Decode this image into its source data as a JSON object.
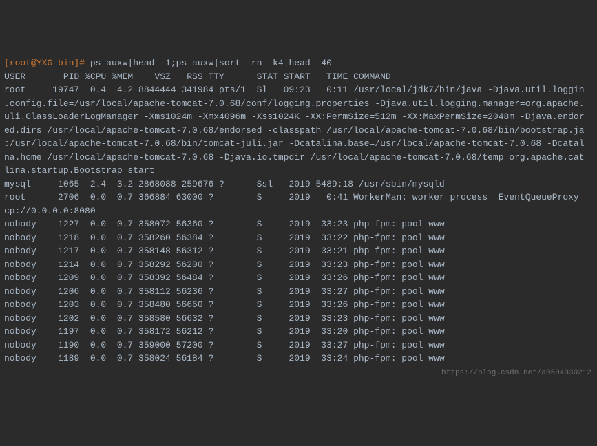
{
  "prompt": "[root@YXG bin]# ",
  "command": "ps auxw|head -1;ps auxw|sort -rn -k4|head -40",
  "header": "USER       PID %CPU %MEM    VSZ   RSS TTY      STAT START   TIME COMMAND",
  "wrapped_process": "root     19747  0.4  4.2 8844444 341984 pts/1  Sl   09:23   0:11 /usr/local/jdk7/bin/java -Djava.util.loggin\n.config.file=/usr/local/apache-tomcat-7.0.68/conf/logging.properties -Djava.util.logging.manager=org.apache.\nuli.ClassLoaderLogManager -Xms1024m -Xmx4096m -Xss1024K -XX:PermSize=512m -XX:MaxPermSize=2048m -Djava.endor\ned.dirs=/usr/local/apache-tomcat-7.0.68/endorsed -classpath /usr/local/apache-tomcat-7.0.68/bin/bootstrap.ja\n:/usr/local/apache-tomcat-7.0.68/bin/tomcat-juli.jar -Dcatalina.base=/usr/local/apache-tomcat-7.0.68 -Dcatal\nna.home=/usr/local/apache-tomcat-7.0.68 -Djava.io.tmpdir=/usr/local/apache-tomcat-7.0.68/temp org.apache.cat\nlina.startup.Bootstrap start",
  "rows": [
    "mysql     1065  2.4  3.2 2868088 259676 ?      Ssl   2019 5489:18 /usr/sbin/mysqld",
    "root      2706  0.0  0.7 366884 63000 ?        S     2019   0:41 WorkerMan: worker process  EventQueueProxy\ncp://0.0.0.0:8080",
    "nobody    1227  0.0  0.7 358072 56360 ?        S     2019  33:23 php-fpm: pool www",
    "nobody    1218  0.0  0.7 358260 56384 ?        S     2019  33:22 php-fpm: pool www",
    "nobody    1217  0.0  0.7 358148 56312 ?        S     2019  33:21 php-fpm: pool www",
    "nobody    1214  0.0  0.7 358292 56200 ?        S     2019  33:23 php-fpm: pool www",
    "nobody    1209  0.0  0.7 358392 56484 ?        S     2019  33:26 php-fpm: pool www",
    "nobody    1206  0.0  0.7 358112 56236 ?        S     2019  33:27 php-fpm: pool www",
    "nobody    1203  0.0  0.7 358480 56660 ?        S     2019  33:26 php-fpm: pool www",
    "nobody    1202  0.0  0.7 358580 56632 ?        S     2019  33:23 php-fpm: pool www",
    "nobody    1197  0.0  0.7 358172 56212 ?        S     2019  33:20 php-fpm: pool www",
    "nobody    1190  0.0  0.7 359000 57200 ?        S     2019  33:27 php-fpm: pool www",
    "nobody    1189  0.0  0.7 358024 56184 ?        S     2019  33:24 php-fpm: pool www"
  ],
  "watermark": "https://blog.csdn.net/a0604030212"
}
